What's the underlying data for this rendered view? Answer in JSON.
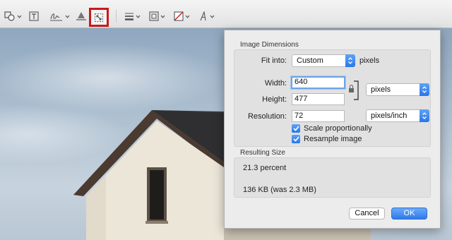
{
  "toolbar": {
    "tools": [
      {
        "icon": "shapes-icon"
      },
      {
        "icon": "text-icon"
      },
      {
        "icon": "signature-icon"
      },
      {
        "icon": "adjust-color-icon"
      },
      {
        "icon": "adjust-size-icon",
        "highlighted": true
      },
      {
        "icon": "shape-style-icon"
      },
      {
        "icon": "border-color-icon"
      },
      {
        "icon": "fill-color-icon"
      },
      {
        "icon": "text-style-icon"
      }
    ],
    "highlight_color": "#c8191b"
  },
  "dialog": {
    "image_dimensions": {
      "title": "Image Dimensions",
      "fit_into_label": "Fit into:",
      "fit_into_value": "Custom",
      "fit_into_unit": "pixels",
      "width_label": "Width:",
      "width_value": "640",
      "height_label": "Height:",
      "height_value": "477",
      "size_unit": "pixels",
      "resolution_label": "Resolution:",
      "resolution_value": "72",
      "resolution_unit": "pixels/inch",
      "scale_proportionally_label": "Scale proportionally",
      "scale_proportionally_checked": true,
      "resample_label": "Resample image",
      "resample_checked": true
    },
    "resulting_size": {
      "title": "Resulting Size",
      "percent": "21.3 percent",
      "file_size": "136 KB (was 2.3 MB)"
    },
    "buttons": {
      "cancel": "Cancel",
      "ok": "OK"
    }
  },
  "colors": {
    "accent": "#2f7ae9",
    "dialog_bg": "#ececec",
    "toolbar_bg": "#e8e8e8"
  }
}
